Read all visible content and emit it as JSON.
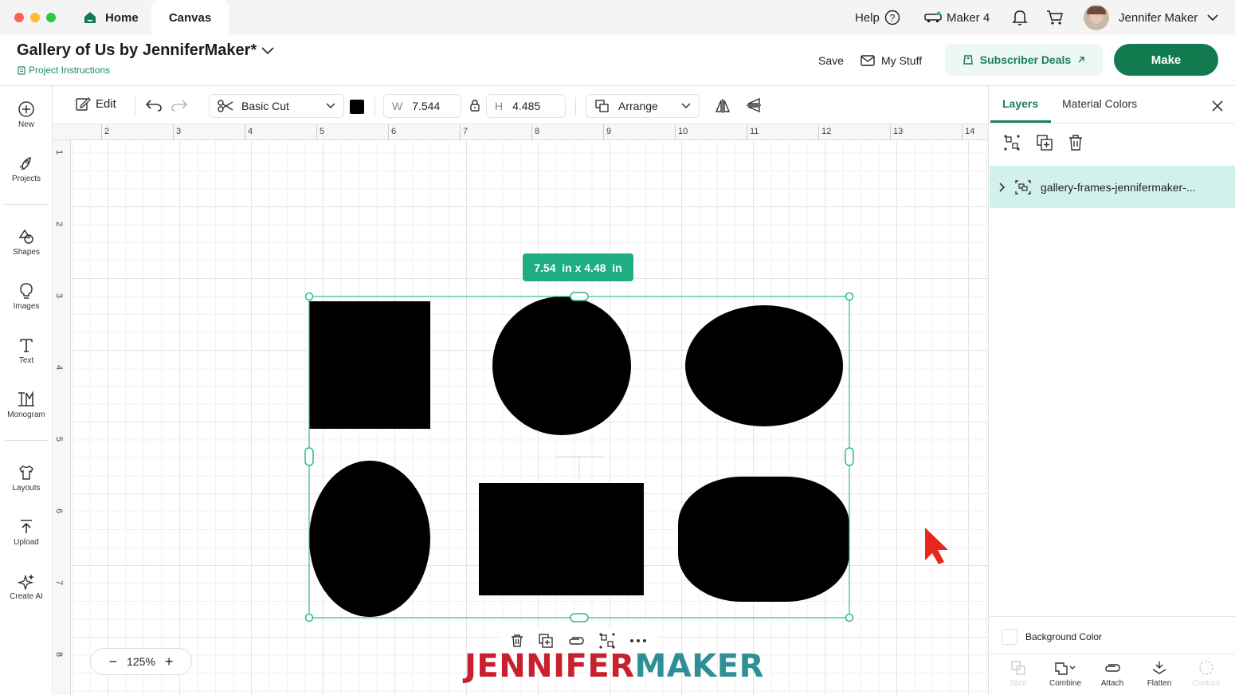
{
  "titlebar": {
    "tabs": [
      {
        "label": "Home"
      },
      {
        "label": "Canvas"
      }
    ],
    "help_label": "Help",
    "machine_label": "Maker 4",
    "user_name": "Jennifer Maker"
  },
  "header": {
    "project_title": "Gallery of Us by JenniferMaker*",
    "project_instructions": "Project Instructions",
    "save_label": "Save",
    "my_stuff_label": "My Stuff",
    "subscriber_deals_label": "Subscriber Deals",
    "make_label": "Make"
  },
  "sidebar": {
    "items": [
      {
        "label": "New",
        "icon": "plus-circle-icon"
      },
      {
        "label": "Projects",
        "icon": "rocket-icon"
      },
      {
        "label": "Shapes",
        "icon": "shapes-icon"
      },
      {
        "label": "Images",
        "icon": "bulb-icon"
      },
      {
        "label": "Text",
        "icon": "text-icon"
      },
      {
        "label": "Monogram",
        "icon": "monogram-icon"
      },
      {
        "label": "Layouts",
        "icon": "shirt-icon"
      },
      {
        "label": "Upload",
        "icon": "upload-icon"
      },
      {
        "label": "Create AI",
        "icon": "sparkle-icon"
      }
    ]
  },
  "toolbar": {
    "edit_label": "Edit",
    "operation": "Basic Cut",
    "color_swatch": "#000000",
    "width_label": "W",
    "width_value": "7.544",
    "height_label": "H",
    "height_value": "4.485",
    "arrange_label": "Arrange"
  },
  "rulers": {
    "top": [
      "2",
      "3",
      "4",
      "5",
      "6",
      "7",
      "8",
      "9",
      "10",
      "11",
      "12",
      "13",
      "14"
    ],
    "left": [
      "1",
      "2",
      "3",
      "4",
      "5",
      "6",
      "7",
      "8"
    ]
  },
  "canvas": {
    "size_badge": "7.54  in x 4.48  in",
    "zoom": "125%",
    "watermark_part1": "JENNIFER",
    "watermark_part2": "MAKER",
    "watermark_colors": {
      "part1": "#c8202e",
      "part2": "#2e8f97"
    },
    "selection_color": "#2fb996",
    "shape_color": "#000000",
    "cursor_color": "#e8261b"
  },
  "right_panel": {
    "tabs": [
      {
        "label": "Layers",
        "active": true
      },
      {
        "label": "Material Colors",
        "active": false
      }
    ],
    "layer_name": "gallery-frames-jennifermaker-...",
    "background_color_label": "Background Color",
    "bottom_actions": [
      {
        "label": "Slice",
        "enabled": false
      },
      {
        "label": "Combine",
        "enabled": true
      },
      {
        "label": "Attach",
        "enabled": true
      },
      {
        "label": "Flatten",
        "enabled": true
      },
      {
        "label": "Contour",
        "enabled": false
      }
    ]
  },
  "colors": {
    "accent_green": "#1a7f5a",
    "make_button": "#127a4f",
    "layer_selected_bg": "#d3f1ec",
    "subscriber_bg": "#edf7f4"
  }
}
